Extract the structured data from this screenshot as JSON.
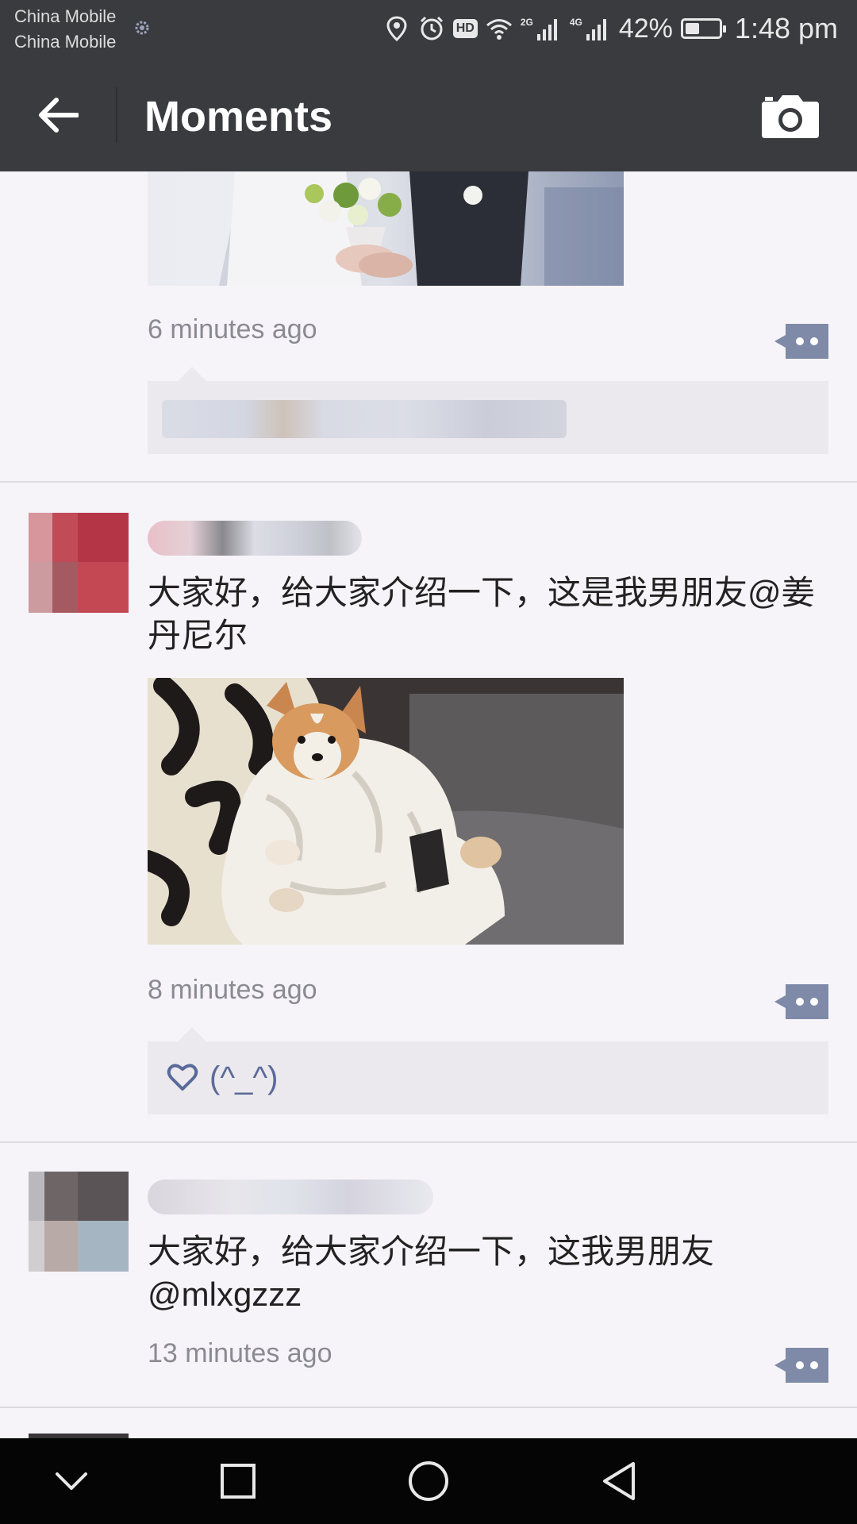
{
  "status_bar": {
    "carrier_1": "China Mobile",
    "carrier_2": "China Mobile",
    "network_1": "2G",
    "network_2": "4G",
    "battery_percent": "42%",
    "battery_level": 0.42,
    "time": "1:48 pm",
    "icons": [
      "location-icon",
      "alarm-icon",
      "hd-icon",
      "wifi-icon",
      "signal-icon",
      "signal-icon",
      "battery-icon"
    ]
  },
  "header": {
    "title": "Moments",
    "back_icon": "arrow-left-icon",
    "camera_icon": "camera-icon"
  },
  "posts": [
    {
      "time": "6 minutes ago",
      "photo": "wedding-bouquet-photo",
      "has_comments": true
    },
    {
      "text": "大家好，给大家介绍一下，这是我男朋友@姜丹尼尔",
      "photo": "corgi-in-blanket-photo",
      "time": "8 minutes ago",
      "like_text": "(^_^)"
    },
    {
      "text": "大家好，给大家介绍一下，这我男朋友@mlxgzzz",
      "time": "13 minutes ago"
    }
  ],
  "nav": {
    "icons": [
      "chevron-down-icon",
      "recent-apps-icon",
      "home-icon",
      "back-triangle-icon"
    ]
  },
  "colors": {
    "bar": "#3a3b3f",
    "feed_bg": "#f6f4f8",
    "link": "#5a6a98",
    "comment_icon": "#7e8aa8"
  }
}
